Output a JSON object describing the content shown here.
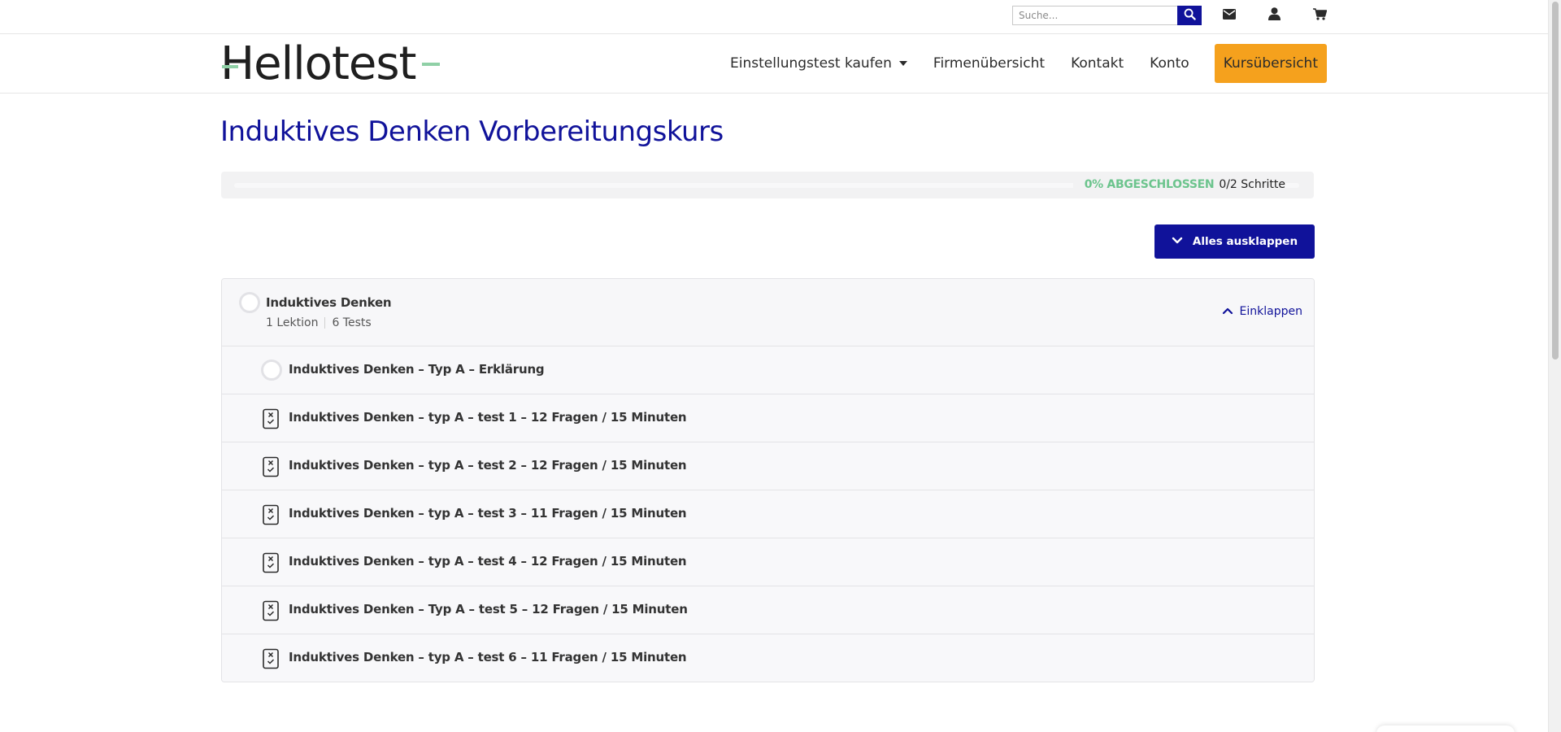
{
  "topbar": {
    "search_placeholder": "Suche...",
    "icons": [
      "search-icon",
      "envelope-icon",
      "user-icon",
      "cart-icon"
    ]
  },
  "header": {
    "logo_text": "Hellotest",
    "nav": [
      {
        "label": "Einstellungstest kaufen",
        "has_dropdown": true
      },
      {
        "label": "Firmenübersicht"
      },
      {
        "label": "Kontakt"
      },
      {
        "label": "Konto"
      }
    ],
    "cta_label": "Kursübersicht"
  },
  "main": {
    "title": "Induktives Denken Vorbereitungskurs",
    "progress": {
      "percent_label": "0% ABGESCHLOSSEN",
      "steps_label": "0/2 Schritte",
      "fraction": 0
    },
    "expand_all_label": "Alles ausklappen",
    "section": {
      "title": "Induktives Denken",
      "lessons": "1 Lektion",
      "tests": "6 Tests",
      "collapse_label": "Einklappen",
      "items": [
        {
          "label": "Induktives Denken – Typ A – Erklärung",
          "type": "lesson"
        },
        {
          "label": "Induktives Denken – typ A – test 1 – 12 Fragen / 15 Minuten",
          "type": "quiz"
        },
        {
          "label": "Induktives Denken – typ A – test 2 – 12 Fragen / 15 Minuten",
          "type": "quiz"
        },
        {
          "label": "Induktives Denken – typ A – test 3 – 11 Fragen / 15 Minuten",
          "type": "quiz"
        },
        {
          "label": "Induktives Denken – typ A – test 4 – 12 Fragen / 15 Minuten",
          "type": "quiz"
        },
        {
          "label": "Induktives Denken – Typ A – test 5 – 12 Fragen / 15 Minuten",
          "type": "quiz"
        },
        {
          "label": "Induktives Denken – typ A – test 6 – 11 Fragen / 15 Minuten",
          "type": "quiz"
        }
      ]
    }
  },
  "colors": {
    "brand_blue": "#10129a",
    "accent_orange": "#f5a11d",
    "progress_green": "#6cc48d",
    "logo_green": "#8fd0a6"
  }
}
